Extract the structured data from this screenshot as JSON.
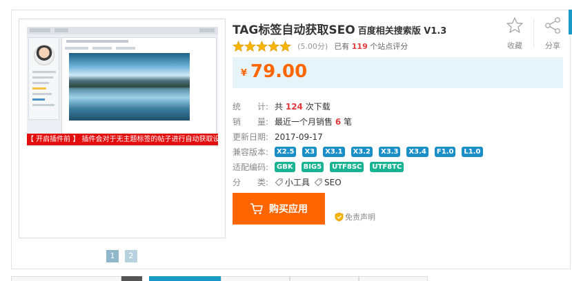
{
  "product": {
    "title": "TAG标签自动获取SEO",
    "subtitle": "百度相关搜索版 V1.3",
    "rating_score": "(5.00分)",
    "rating_prefix": "已有",
    "rating_count": "119",
    "rating_suffix": "个站点评分",
    "stars": 5,
    "price_currency": "¥",
    "price_amount": "79.00"
  },
  "actions": {
    "favorite_label": "收藏",
    "share_label": "分享",
    "buy_label": "购买应用",
    "disclaimer_label": "免责声明"
  },
  "preview": {
    "banner_text": "【 开启插件前 】 插件会对于无主题标签的帖子进行自动获取设置",
    "pages": [
      "1",
      "2"
    ]
  },
  "info": {
    "downloads": {
      "key": "统　　计:",
      "prefix": "共",
      "value": "124",
      "suffix": "次下载"
    },
    "sales": {
      "key": "销　　量:",
      "prefix": "最近一个月销售",
      "value": "6",
      "suffix": "笔"
    },
    "updated": {
      "key": "更新日期:",
      "value": "2017-09-17"
    },
    "compat": {
      "key": "兼容版本:",
      "tags": [
        "X2.5",
        "X3",
        "X3.1",
        "X3.2",
        "X3.3",
        "X3.4",
        "F1.0",
        "L1.0"
      ]
    },
    "encoding": {
      "key": "适配编码:",
      "tags": [
        "GBK",
        "BIG5",
        "UTF8SC",
        "UTF8TC"
      ]
    },
    "category": {
      "key": "分　　类:",
      "items": [
        "小工具",
        "SEO"
      ]
    }
  },
  "colors": {
    "accent_orange": "#ff6600",
    "price_bg": "#e6f4fa",
    "version_tag": "#1a8fc7",
    "encoding_tag": "#19b394",
    "highlight_red": "#e4393c",
    "star_gold": "#f7b500"
  }
}
